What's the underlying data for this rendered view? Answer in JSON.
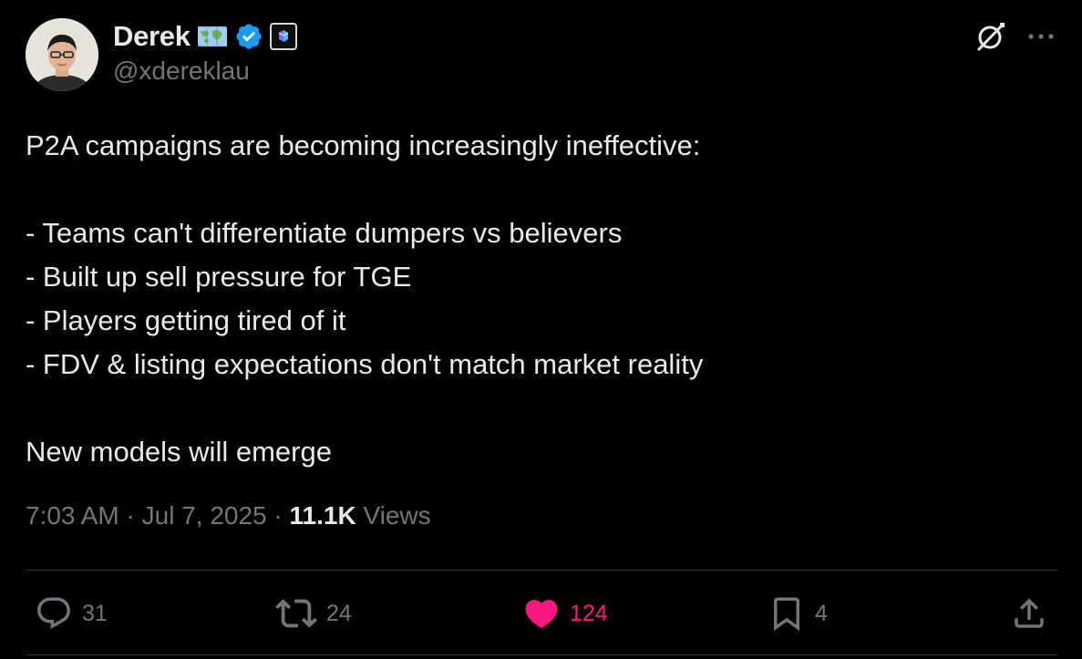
{
  "author": {
    "display_name": "Derek",
    "handle": "@xdereklau",
    "emoji_icon": "world-map-emoji",
    "verified_icon": "verified-badge-icon",
    "affiliate_icon": "affiliate-badge-icon"
  },
  "tweet": {
    "lines": [
      "P2A campaigns are becoming increasingly ineffective:",
      "",
      "- Teams can't differentiate dumpers vs believers",
      "- Built up sell pressure for TGE",
      "- Players getting tired of it",
      "- FDV & listing expectations don't match market reality",
      "",
      "New models will emerge"
    ]
  },
  "meta": {
    "time": "7:03 AM",
    "separator": " · ",
    "date": "Jul 7, 2025",
    "views_count": "11.1K",
    "views_label": " Views"
  },
  "actions": {
    "replies": "31",
    "reposts": "24",
    "likes": "124",
    "bookmarks": "4"
  },
  "colors": {
    "background": "#000000",
    "text": "#e7e9ea",
    "muted": "#71767b",
    "like": "#f91880",
    "verified": "#1d9bf0",
    "divider": "#2f3336"
  }
}
